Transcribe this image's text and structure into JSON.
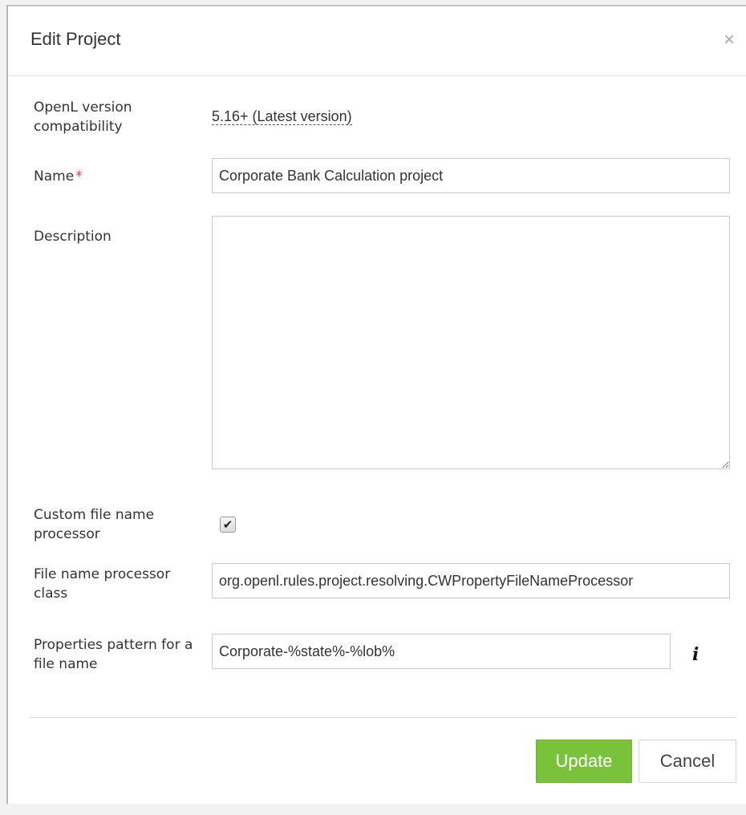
{
  "dialog": {
    "title": "Edit Project",
    "close_symbol": "×"
  },
  "fields": {
    "version": {
      "label": "OpenL version compatibility",
      "value": "5.16+ (Latest version)"
    },
    "name": {
      "label": "Name",
      "required_mark": "*",
      "value": "Corporate Bank Calculation project"
    },
    "description": {
      "label": "Description",
      "value": ""
    },
    "custom_processor": {
      "label": "Custom file name processor",
      "checked": true,
      "check_symbol": "✔"
    },
    "processor_class": {
      "label": "File name processor class",
      "value": "org.openl.rules.project.resolving.CWPropertyFileNameProcessor"
    },
    "properties_pattern": {
      "label": "Properties pattern for a file name",
      "value": "Corporate-%state%-%lob%",
      "info_symbol": "i"
    }
  },
  "buttons": {
    "update": "Update",
    "cancel": "Cancel"
  },
  "icons": {
    "close": "close-icon",
    "info": "info-icon",
    "check": "checkmark-icon"
  },
  "colors": {
    "primary_button": "#7bc23c",
    "required": "#e23b3b"
  }
}
